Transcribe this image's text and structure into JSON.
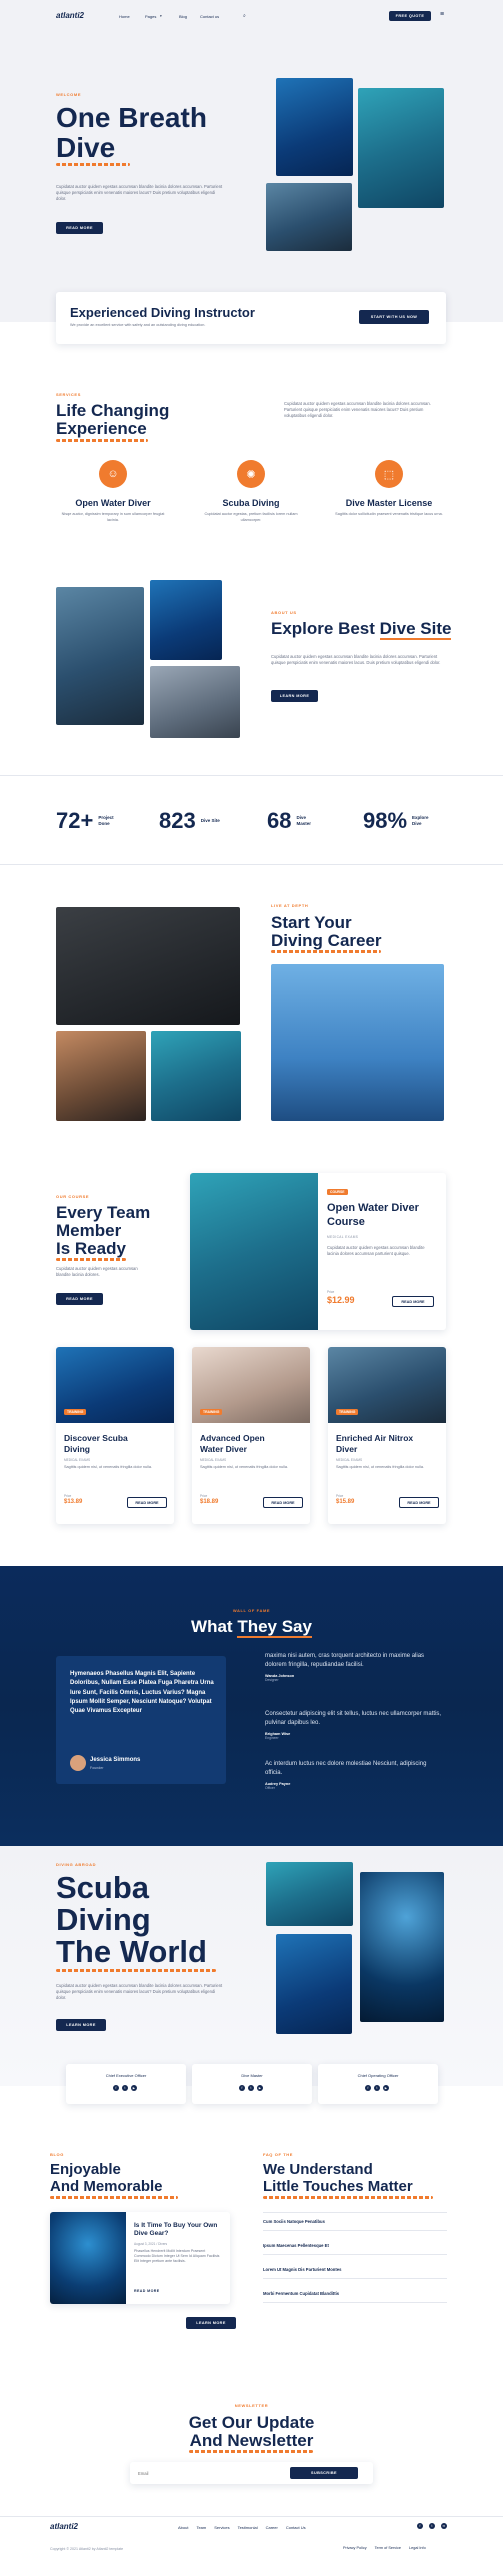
{
  "nav": {
    "logo": "atlanti2",
    "links": [
      "Home",
      "Pages",
      "Blog",
      "Contact us"
    ],
    "cta": "FREE QUOTE"
  },
  "hero": {
    "eyebrow": "WELCOME",
    "title_line1": "One Breath",
    "title_line2": "Dive",
    "desc": "Cupidatat auctor quidem egestas accumsan blandite lacinia dolores accumsan. Parturient quisque perspiciatis enim venenatis maiores lacus? Duis pretium voluptatibus eligendi dolor.",
    "button": "READ MORE"
  },
  "instructor": {
    "title": "Experienced Diving Instructor",
    "desc": "We provide an excellent service with safety and an outstanding diving education.",
    "button": "START WITH US NOW"
  },
  "changing": {
    "eyebrow": "SERVICES",
    "title_line1": "Life Changing",
    "title_line2": "Experience",
    "desc": "Cupidatat auctor quidem egestas accumsan blandite lacinia dolores accumsan. Parturient quisque perspiciatis enim venenatis maiores lacus? Duis pretium voluptatibus eligendi dolor.",
    "features": [
      {
        "title": "Open Water Diver",
        "desc": "Nisqe auctor, dignissim temporary in sum ullamcorper feugiat lacinia.",
        "icon": "diver-icon"
      },
      {
        "title": "Scuba Diving",
        "desc": "Cupidatat auctor egestas, pretium facilisis lorem nullam ullamcorper.",
        "icon": "scuba-icon"
      },
      {
        "title": "Dive Master License",
        "desc": "Sagittis dolor sollicitudin praesent venenatis tristique lacus urna.",
        "icon": "license-icon"
      }
    ]
  },
  "explore": {
    "eyebrow": "ABOUT US",
    "title_pre": "Explore Best ",
    "title_hl": "Dive Site",
    "desc": "Cupidatat auctor quidem egestas accumsan blandite lacinia dolores accumsan. Parturient quisque perspiciatis enim venenatis maiores lacus. Duis pretium voluptatibus eligendi dolor.",
    "button": "LEARN MORE"
  },
  "stats": [
    {
      "num": "72+",
      "label": "Project\nDone"
    },
    {
      "num": "823",
      "label": "Dive Site"
    },
    {
      "num": "68",
      "label": "Dive\nMaster"
    },
    {
      "num": "98%",
      "label": "Explore\nDive"
    }
  ],
  "career": {
    "eyebrow": "LIVE AT DEPTH",
    "title_line1": "Start Your",
    "title_line2": "Diving Career"
  },
  "team": {
    "eyebrow": "OUR COURSE",
    "title_line1": "Every Team",
    "title_line2": "Member",
    "title_line3": "Is Ready",
    "desc": "Cupidatat auctor quidem egestas accumsan blandite lacinia dolores.",
    "button": "READ MORE"
  },
  "featured_course": {
    "badge": "COURSE",
    "title_line1": "Open Water Diver",
    "title_line2": "Course",
    "sub": "MEDICAL EXAMS",
    "desc": "Cupidatat auctor quidem egestas accumsan blandite lacinia dolores accumsan parturient quisque.",
    "price_label": "Price",
    "price": "$12.99",
    "button": "READ MORE"
  },
  "courses": [
    {
      "badge": "TRAINING",
      "title_line1": "Discover Scuba",
      "title_line2": "Diving",
      "sub": "MEDICAL EXAMS",
      "desc": "Sagittis quidem nisl, ut venenatis fringilla dolor nulla.",
      "price_label": "Price",
      "price": "$13.89",
      "button": "READ MORE"
    },
    {
      "badge": "TRAINING",
      "title_line1": "Advanced Open",
      "title_line2": "Water Diver",
      "sub": "MEDICAL EXAMS",
      "desc": "Sagittis quidem nisl, ut venenatis fringilla dolor nulla.",
      "price_label": "Price",
      "price": "$18.89",
      "button": "READ MORE"
    },
    {
      "badge": "TRAINING",
      "title_line1": "Enriched Air Nitrox",
      "title_line2": "Diver",
      "sub": "MEDICAL EXAMS",
      "desc": "Sagittis quidem nisl, ut venenatis fringilla dolor nulla.",
      "price_label": "Price",
      "price": "$15.89",
      "button": "READ MORE"
    }
  ],
  "testimonials": {
    "eyebrow": "WALL OF FAME",
    "title_pre": "What ",
    "title_hl": "They Say",
    "quote": "Hymenaeos Phasellus Magnis Elit, Sapiente Doloribus, Nullam Esse Platea Fuga Pharetra Urna Iure Sunt, Facilis Omnis, Luctus Varius? Magna Ipsum Mollit Semper, Nesciunt Natoque? Volutpat Quae Vivamus Excepteur",
    "author": "Jessica Simmons",
    "author_role": "Founder",
    "right": [
      {
        "text": "maxima nisi autem, cras torquent architecto in maxime alias dolorem fringilla, repudiandae facilisi.",
        "name": "Wanda Johnson",
        "role": "Designer"
      },
      {
        "text": "Consectetur adipiscing elit sit tellus, luctus nec ullamcorper mattis, pulvinar dapibus leo.",
        "name": "Brigham Wise",
        "role": "Engineer"
      },
      {
        "text": "Ac interdum luctus nec dolore molestiae Nesciunt, adipiscing officia.",
        "name": "Audrey Payne",
        "role": "Officer"
      }
    ]
  },
  "world": {
    "eyebrow": "DIVING ABROAD",
    "title_line1": "Scuba",
    "title_line2": "Diving",
    "title_line3": "The World",
    "desc": "Cupidatat auctor quidem egestas accumsan blandite lacinia dolores accumsan. Parturient quisque perspiciatis enim venenatis maiores lacus? Duis pretium voluptatibus eligendi dolor.",
    "button": "LEARN MORE"
  },
  "officers": [
    "Chief Executive Officer",
    "Dive Master",
    "Chief Operating Officer"
  ],
  "enjoyable": {
    "eyebrow": "BLOG",
    "title_line1": "Enjoyable",
    "title_line2": "And Memorable",
    "post_title": "Is It Time To Buy Your Own Dive Gear?",
    "post_meta": "August 3, 2021 / Divers",
    "post_desc": "Phasellus Hendrerit Mollit Interdum Praesent Commodo Dictum Integer Ut Sem Id Aliquam Facilisis Elit Integer pretium ante facilisis.",
    "post_link": "READ MORE",
    "button": "LEARN MORE"
  },
  "understand": {
    "eyebrow": "FAQ OF THE",
    "title_line1": "We Understand",
    "title_line2": "Little Touches Matter",
    "items": [
      "Cum Sociis Natoque Penatibus",
      "Ipsum Maecenas Pellentesque Et",
      "Lorem Ut Magnis Dis Parturient Montes",
      "Morbi Fermentum Cupidatat Blandittis"
    ]
  },
  "newsletter": {
    "eyebrow": "NEWSLETTER",
    "title_line1": "Get Our Update",
    "title_line2": "And Newsletter",
    "placeholder": "Email",
    "button": "SUBSCRIBE"
  },
  "footer": {
    "logo": "atlanti2",
    "links": [
      "About",
      "Team",
      "Services",
      "Testimonial",
      "Career",
      "Contact Us"
    ],
    "copyright": "Copyright © 2021 Atlanti2 by Atlanti2 template",
    "policies": [
      "Privacy Policy",
      "Term of Service",
      "Legal Info"
    ]
  },
  "colors": {
    "navy": "#142850",
    "orange": "#f07b2e"
  }
}
